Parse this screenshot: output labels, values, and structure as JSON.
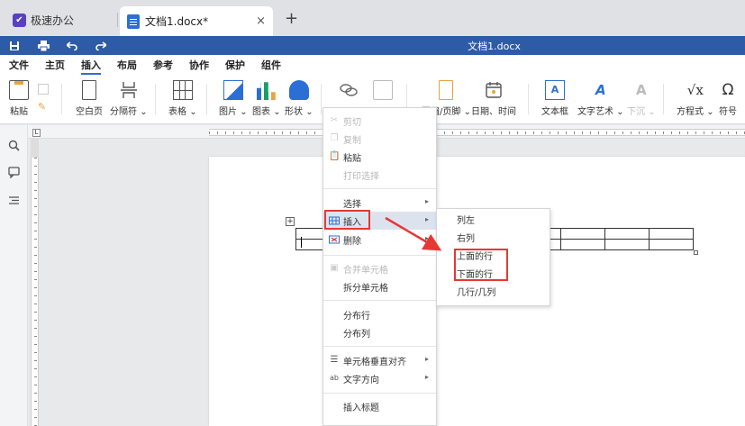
{
  "tabs": {
    "app_name": "极速办公",
    "document_tab": "文档1.docx*",
    "close": "×",
    "new_tab": "+"
  },
  "titlebar": {
    "title": "文档1.docx"
  },
  "menubar": {
    "items": [
      "文件",
      "主页",
      "插入",
      "布局",
      "参考",
      "协作",
      "保护",
      "组件"
    ],
    "active": "插入"
  },
  "ribbon": {
    "paste": "粘贴",
    "blank_page": "空白页",
    "page_break": "分隔符",
    "table": "表格",
    "image": "图片",
    "chart": "图表",
    "shape": "形状",
    "header_footer": "页眉/页脚",
    "date_time": "日期、时间",
    "textbox": "文本框",
    "wordart": "文字艺术",
    "dropcap": "下沉",
    "equation": "方程式",
    "symbol": "符号",
    "dropdown": "⌄"
  },
  "context_menu": {
    "cut": "剪切",
    "copy": "复制",
    "paste": "粘贴",
    "print_selection": "打印选择",
    "select": "选择",
    "insert": "插入",
    "delete": "删除",
    "merge_cells": "合并单元格",
    "split_cells": "拆分单元格",
    "distribute_rows": "分布行",
    "distribute_cols": "分布列",
    "cell_vertical_align": "单元格垂直对齐",
    "text_direction": "文字方向",
    "insert_caption": "插入标题",
    "submenu_arrow": "▸"
  },
  "submenu": {
    "col_left": "列左",
    "col_right": "右列",
    "row_above": "上面的行",
    "row_below": "下面的行",
    "rows_cols": "几行/几列"
  },
  "colors": {
    "accent": "#2b6fd6",
    "titlebar": "#2e5ba8",
    "annotation": "#e53935"
  }
}
